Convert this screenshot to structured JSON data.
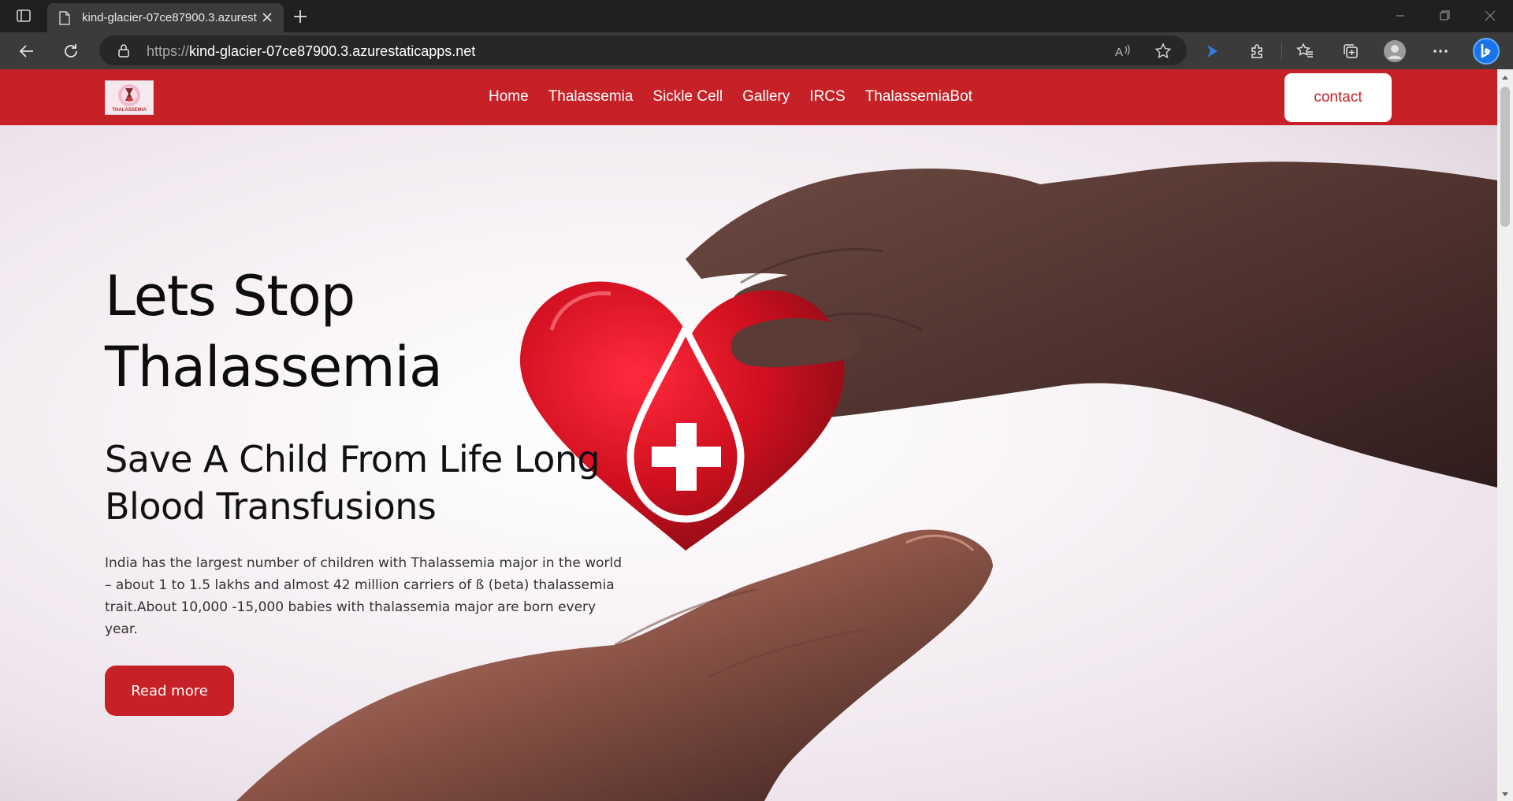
{
  "browser": {
    "tab_title": "kind-glacier-07ce87900.3.azurest",
    "url_scheme": "https://",
    "url_host": "kind-glacier-07ce87900.3.azurestaticapps.net",
    "icons": [
      "tab-actions-icon",
      "page-icon",
      "close-icon",
      "plus-icon",
      "minimize-icon",
      "restore-icon",
      "close-window-icon",
      "back-icon",
      "refresh-icon",
      "lock-icon",
      "read-aloud-icon",
      "favorite-star-icon",
      "copilot-icon",
      "extensions-icon",
      "favorites-icon",
      "collections-icon",
      "profile-icon",
      "more-icon",
      "bing-icon"
    ]
  },
  "site": {
    "logo_text": "THALASSEMIA",
    "nav": [
      "Home",
      "Thalassemia",
      "Sickle Cell",
      "Gallery",
      "IRCS",
      "ThalassemiaBot"
    ],
    "contact_label": "contact",
    "brand_color": "#c62127"
  },
  "hero": {
    "title": "Lets Stop Thalassemia",
    "subtitle": "Save A Child From Life Long Blood Transfusions",
    "description": "India has the largest number of children with Thalassemia major in the world – about 1 to 1.5 lakhs and almost 42 million carriers of ß (beta) thalassemia trait.About 10,000 -15,000 babies with thalassemia major are born every year.",
    "read_more_label": "Read more"
  }
}
